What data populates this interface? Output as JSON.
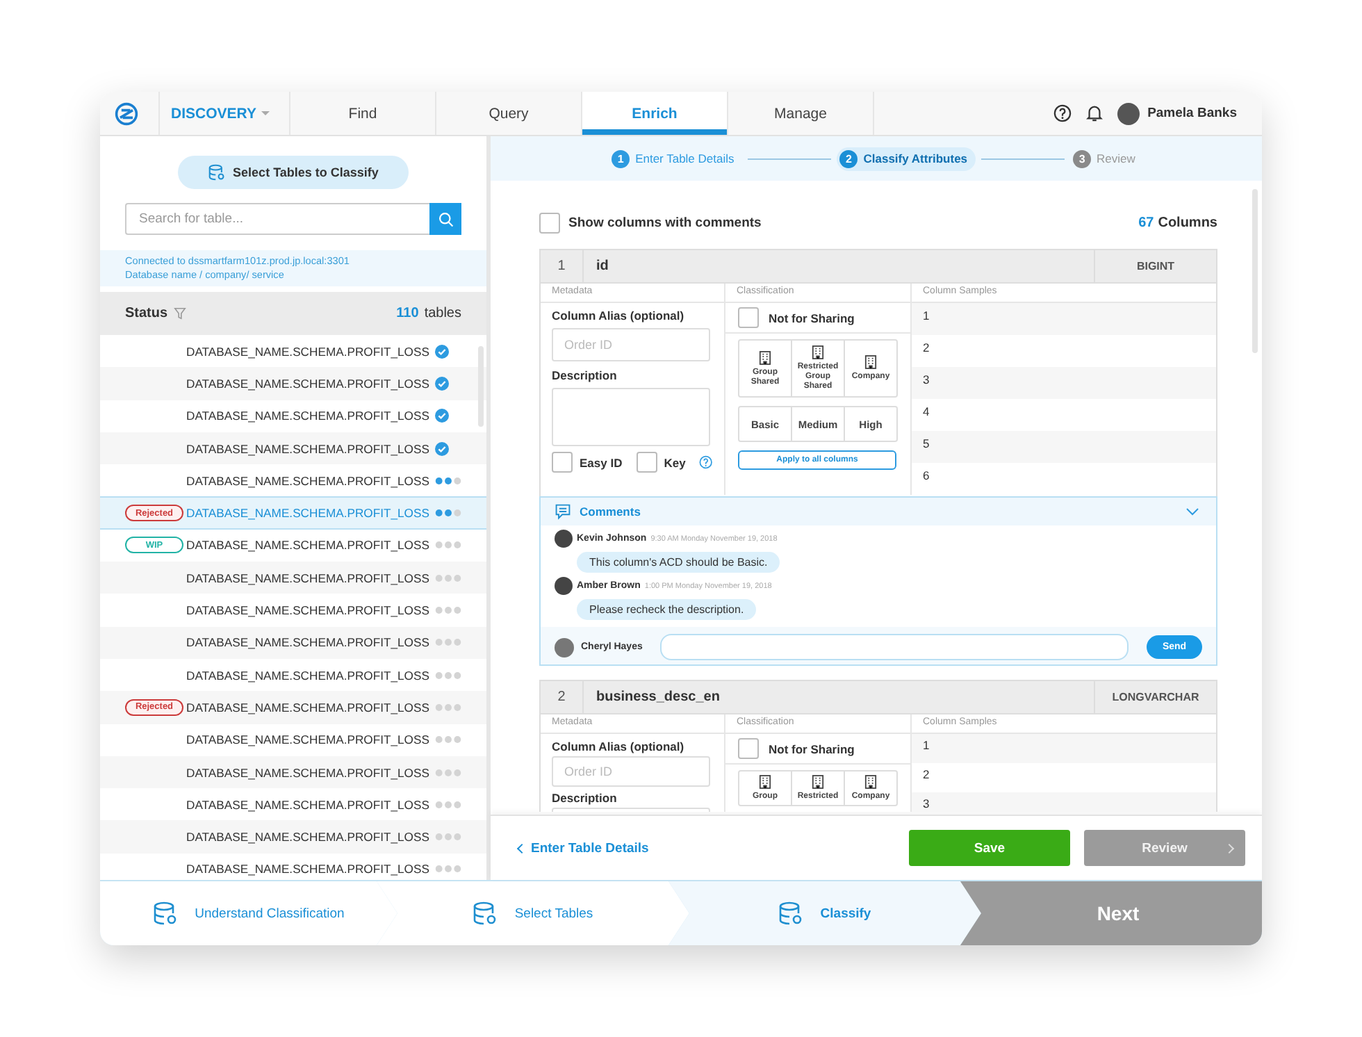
{
  "nav": {
    "app_menu": "DISCOVERY",
    "tabs": [
      {
        "label": "Find",
        "selected": false
      },
      {
        "label": "Query",
        "selected": false
      },
      {
        "label": "Enrich",
        "selected": true
      },
      {
        "label": "Manage",
        "selected": false
      }
    ],
    "user": "Pamela Banks"
  },
  "left_panel": {
    "select_button": "Select Tables to Classify",
    "search": {
      "placeholder": "Search for table..."
    },
    "connection": [
      "Connected to dssmartfarm101z.prod.jp.local:3301",
      "Database name / company/ service"
    ],
    "status_label": "Status",
    "count": "110",
    "count_unit": "tables",
    "rows": [
      {
        "name": "DATABASE_NAME.SCHEMA.PROFIT_LOSS",
        "kind": "complete",
        "selected": false
      },
      {
        "name": "DATABASE_NAME.SCHEMA.PROFIT_LOSS",
        "kind": "complete",
        "selected": false
      },
      {
        "name": "DATABASE_NAME.SCHEMA.PROFIT_LOSS",
        "kind": "complete",
        "selected": false
      },
      {
        "name": "DATABASE_NAME.SCHEMA.PROFIT_LOSS",
        "kind": "complete",
        "selected": false
      },
      {
        "name": "DATABASE_NAME.SCHEMA.PROFIT_LOSS",
        "kind": "progress",
        "level": 0.67,
        "selected": false
      },
      {
        "name": "DATABASE_NAME.SCHEMA.PROFIT_LOSS",
        "kind": "progress",
        "level": 0.67,
        "selected": true,
        "badge": {
          "text": "Rejected",
          "kind": "rejected"
        }
      },
      {
        "name": "DATABASE_NAME.SCHEMA.PROFIT_LOSS",
        "kind": "pending",
        "selected": false,
        "badge": {
          "text": "WIP",
          "kind": "wip"
        }
      },
      {
        "name": "DATABASE_NAME.SCHEMA.PROFIT_LOSS",
        "kind": "pending",
        "selected": false
      },
      {
        "name": "DATABASE_NAME.SCHEMA.PROFIT_LOSS",
        "kind": "pending",
        "selected": false
      },
      {
        "name": "DATABASE_NAME.SCHEMA.PROFIT_LOSS",
        "kind": "pending",
        "selected": false
      },
      {
        "name": "DATABASE_NAME.SCHEMA.PROFIT_LOSS",
        "kind": "pending",
        "selected": false
      },
      {
        "name": "DATABASE_NAME.SCHEMA.PROFIT_LOSS",
        "kind": "pending",
        "selected": false,
        "badge": {
          "text": "Rejected",
          "kind": "rejected"
        }
      },
      {
        "name": "DATABASE_NAME.SCHEMA.PROFIT_LOSS",
        "kind": "pending",
        "selected": false
      },
      {
        "name": "DATABASE_NAME.SCHEMA.PROFIT_LOSS",
        "kind": "pending",
        "selected": false
      },
      {
        "name": "DATABASE_NAME.SCHEMA.PROFIT_LOSS",
        "kind": "pending",
        "selected": false
      },
      {
        "name": "DATABASE_NAME.SCHEMA.PROFIT_LOSS",
        "kind": "pending",
        "selected": false
      },
      {
        "name": "DATABASE_NAME.SCHEMA.PROFIT_LOSS",
        "kind": "pending",
        "selected": false
      }
    ]
  },
  "stepper": [
    {
      "number": "1",
      "label": "Enter Table Details",
      "completed": true,
      "selected": false
    },
    {
      "number": "2",
      "label": "Classify Attributes",
      "completed": false,
      "selected": true
    },
    {
      "number": "3",
      "label": "Review",
      "completed": false,
      "selected": false
    }
  ],
  "show_comments": {
    "label": "Show columns with comments",
    "checked": false
  },
  "columns_count": "67",
  "columns_unit": "Columns",
  "column_cards": [
    {
      "number": "1",
      "name": "id",
      "type": "BIGINT",
      "sections": [
        "Metadata",
        "Classification",
        "Column Samples"
      ],
      "alias_label": "Column Alias (optional)",
      "alias_placeholder": "Order ID",
      "description_label": "Description",
      "easy_id": {
        "label": "Easy ID",
        "checked": false
      },
      "key": {
        "label": "Key",
        "checked": false
      },
      "not_for_sharing": {
        "label": "Not for Sharing",
        "checked": false
      },
      "sharing": [
        "Group Shared",
        "Restricted Group Shared",
        "Company"
      ],
      "levels": [
        "Basic",
        "Medium",
        "High"
      ],
      "apply_button": "Apply to all columns",
      "samples": [
        "1",
        "2",
        "3",
        "4",
        "5",
        "6"
      ],
      "comments": {
        "title": "Comments",
        "items": [
          {
            "author": "Kevin Johnson",
            "time": "9:30 AM Monday November 19, 2018",
            "text": "This column's ACD should be Basic."
          },
          {
            "author": "Amber Brown",
            "time": "1:00 PM Monday November 19, 2018",
            "text": "Please recheck the description."
          }
        ],
        "composer_author": "Cheryl Hayes",
        "send_button": "Send"
      }
    },
    {
      "number": "2",
      "name": "business_desc_en",
      "type": "LONGVARCHAR",
      "sections": [
        "Metadata",
        "Classification",
        "Column Samples"
      ],
      "alias_label": "Column Alias (optional)",
      "alias_placeholder": "Order ID",
      "description_label": "Description",
      "not_for_sharing": {
        "label": "Not for Sharing",
        "checked": false
      },
      "sharing": [
        "Group",
        "Restricted",
        "Company"
      ],
      "samples": [
        "1",
        "2",
        "3"
      ]
    }
  ],
  "footer": {
    "back_link": "Enter Table Details",
    "save_button": "Save",
    "review_button": {
      "label": "Review",
      "disabled": true
    }
  },
  "wizard": {
    "steps": [
      {
        "label": "Understand Classification",
        "selected": false
      },
      {
        "label": "Select Tables",
        "selected": false
      },
      {
        "label": "Classify",
        "selected": true
      }
    ],
    "next_button": "Next"
  }
}
